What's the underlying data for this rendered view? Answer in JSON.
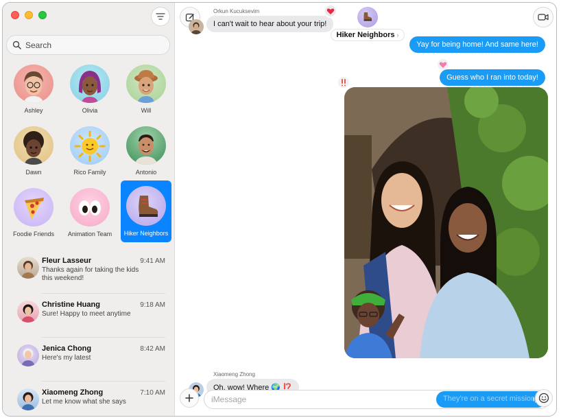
{
  "sidebar": {
    "search_placeholder": "Search",
    "pinned": [
      {
        "name": "Ashley"
      },
      {
        "name": "Olivia"
      },
      {
        "name": "Will"
      },
      {
        "name": "Dawn"
      },
      {
        "name": "Rico Family"
      },
      {
        "name": "Antonio"
      },
      {
        "name": "Foodie Friends"
      },
      {
        "name": "Animation Team"
      },
      {
        "name": "Hiker Neighbors",
        "selected": true
      }
    ],
    "conversations": [
      {
        "name": "Fleur Lasseur",
        "time": "9:41 AM",
        "preview": "Thanks again for taking the kids this weekend!"
      },
      {
        "name": "Christine Huang",
        "time": "9:18 AM",
        "preview": "Sure! Happy to meet anytime"
      },
      {
        "name": "Jenica Chong",
        "time": "8:42 AM",
        "preview": "Here's my latest"
      },
      {
        "name": "Xiaomeng Zhong",
        "time": "7:10 AM",
        "preview": "Let me know what she says"
      }
    ]
  },
  "header": {
    "conversation_name": "Hiker Neighbors",
    "chevron": "›"
  },
  "messages": {
    "m1": {
      "sender": "Orkun Kucuksevim",
      "text": "I can't wait to hear about your trip!"
    },
    "m2": {
      "text": "Yay for being home! And same here!"
    },
    "m3": {
      "text": "Guess who I ran into today!"
    },
    "m4": {
      "sender": "Xiaomeng Zhong",
      "text": "Oh, wow! Where 🌍 ⁉️"
    }
  },
  "composer": {
    "placeholder": "iMessage",
    "sending_text": "They're on a secret mission."
  },
  "colors": {
    "accent": "#0a84ff",
    "outgoing_bubble": "#1a9bf5",
    "incoming_bubble": "#e9e9eb",
    "sidebar_bg": "#efeeed"
  },
  "icons": {
    "filter": "filter-icon",
    "compose": "compose-icon",
    "video": "video-camera-icon",
    "add": "plus-icon",
    "emoji": "emoji-icon",
    "audio": "waveform-icon"
  }
}
